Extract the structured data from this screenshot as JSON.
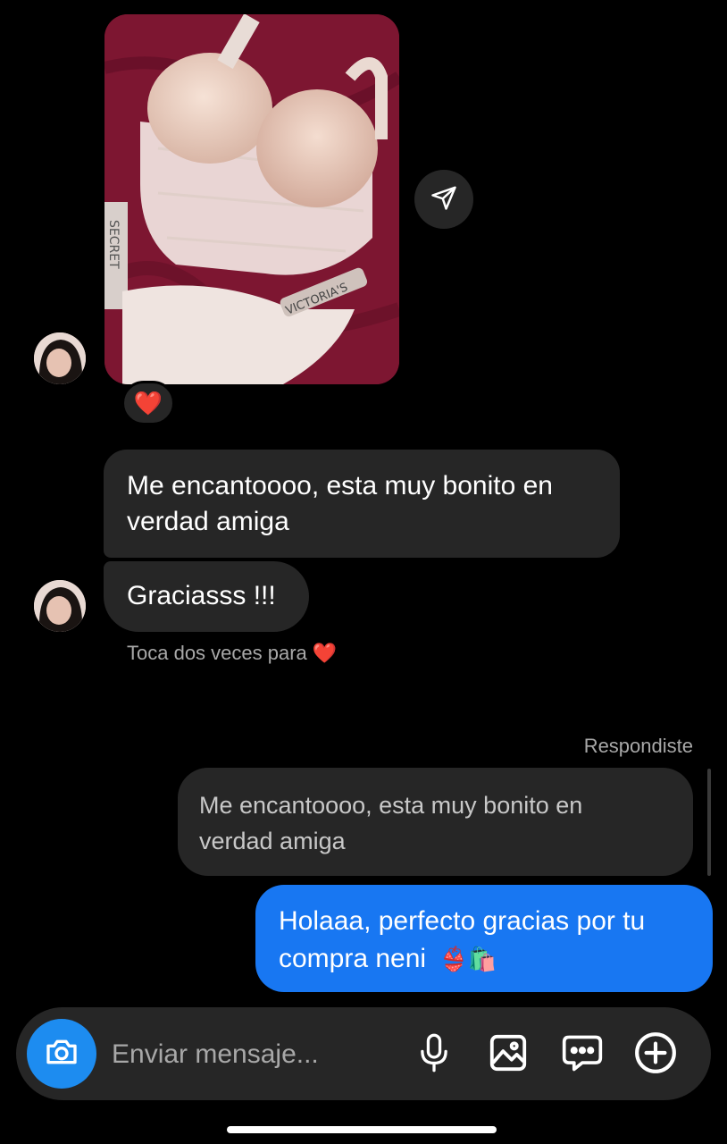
{
  "shared_post": {
    "strap_text_1": "SECRET",
    "strap_text_2": "VICTORIA'S",
    "reaction": "❤️"
  },
  "messages_received": [
    {
      "text_line1": "Me encantoooo, esta muy bonito en",
      "text_line2": "verdad amiga"
    },
    {
      "text": "Graciasss !!!"
    }
  ],
  "hint": {
    "text": "Toca dos veces para",
    "emoji": "❤️"
  },
  "reply": {
    "label": "Respondiste",
    "quoted_line1": "Me encantoooo, esta muy bonito en",
    "quoted_line2": "verdad amiga"
  },
  "message_sent": {
    "text_line1": "Holaaa, perfecto gracias por tu",
    "text_line2": "compra neni",
    "emoji": "👙🛍️"
  },
  "composer": {
    "placeholder": "Enviar mensaje...",
    "icons": [
      "camera-icon",
      "microphone-icon",
      "gallery-icon",
      "sticker-icon",
      "plus-icon"
    ]
  },
  "colors": {
    "accent": "#1877f2",
    "camera": "#1d8cf0",
    "bubble_in": "#262626"
  }
}
